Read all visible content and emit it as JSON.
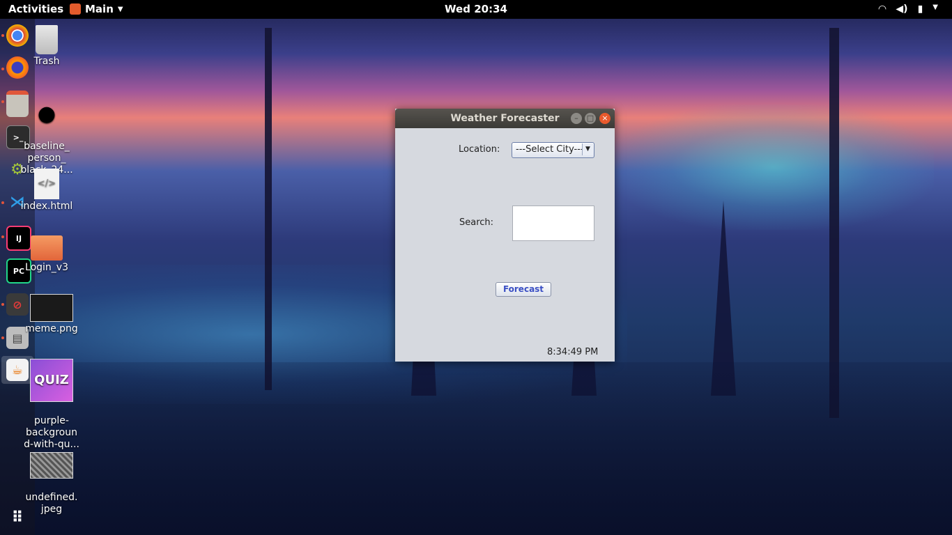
{
  "topbar": {
    "activities": "Activities",
    "app_menu": "Main",
    "clock": "Wed 20:34",
    "tray_icons": [
      "wifi-icon",
      "volume-icon",
      "battery-icon",
      "power-menu-icon"
    ]
  },
  "dock": {
    "items": [
      "chrome",
      "firefox",
      "files",
      "terminal",
      "android-studio",
      "vscode",
      "intellij",
      "pycharm",
      "no-entry-app",
      "printer",
      "java"
    ]
  },
  "desktop": {
    "icons": [
      {
        "label": "Trash"
      },
      {
        "label": "baseline_\nperson_\nblack_24..."
      },
      {
        "label": "index.html"
      },
      {
        "label": "Login_v3"
      },
      {
        "label": "meme.png"
      },
      {
        "label": "purple-\nbackgroun\nd-with-qu..."
      },
      {
        "label": "undefined.\njpeg"
      }
    ]
  },
  "window": {
    "title": "Weather Forecaster",
    "location_label": "Location:",
    "city_select": "---Select City---",
    "search_label": "Search:",
    "search_value": "",
    "forecast_button": "Forecast",
    "time": "8:34:49 PM"
  },
  "colors": {
    "topbar": "#000000",
    "window_bg": "#d6d9df",
    "close_button": "#e95a2d",
    "forecast_text": "#3a4fc4"
  }
}
